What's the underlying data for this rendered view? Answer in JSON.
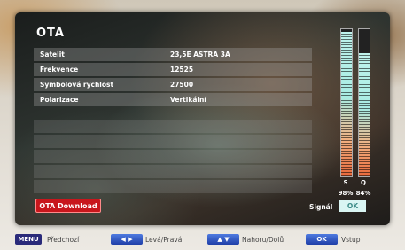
{
  "screen": {
    "title": "OTA",
    "rows": [
      {
        "label": "Satelit",
        "value": "23,5E ASTRA 3A"
      },
      {
        "label": "Frekvence",
        "value": "12525"
      },
      {
        "label": "Symbolová rychlost",
        "value": "27500"
      },
      {
        "label": "Polarizace",
        "value": "Vertikální"
      }
    ],
    "download_button": "OTA Download",
    "signal_label": "Signál",
    "signal_status": "OK"
  },
  "meters": {
    "strength": {
      "label": "S",
      "percent_text": "98%",
      "level": 0.98
    },
    "quality": {
      "label": "Q",
      "percent_text": "84%",
      "level": 0.84
    }
  },
  "hints": {
    "menu_key": "MENU",
    "back": "Předchozí",
    "left_right": "Levá/Pravá",
    "up_down": "Nahoru/Dolů",
    "enter": "Vstup"
  },
  "colors": {
    "download_button": "#c8161c",
    "ok_badge": "#d9f5f3",
    "hint_key": "#1f3fa8"
  }
}
